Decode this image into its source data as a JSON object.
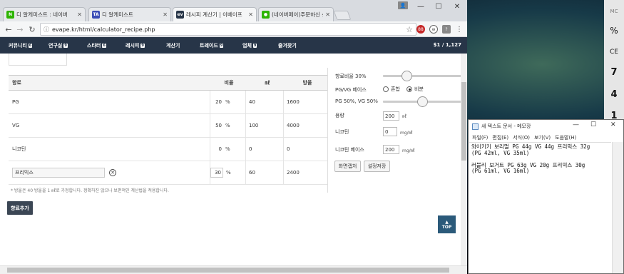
{
  "browser": {
    "tabs": [
      {
        "label": "디 알케미스트 : 네이버",
        "favicon": "N",
        "fav_color": "#2db400",
        "active": false
      },
      {
        "label": "디 알케미스트",
        "favicon": "TA",
        "fav_color": "#3a4bb5",
        "active": false
      },
      {
        "label": "레시피 계산기 | 이베이프",
        "favicon": "ev",
        "fav_color": "#273548",
        "active": true
      },
      {
        "label": "(네이버페이)주문하신 상",
        "favicon": "💬",
        "fav_color": "#2db400",
        "active": false
      }
    ],
    "url": "evape.kr/html/calculator_recipe.php",
    "window_controls": {
      "minimize": "—",
      "maximize": "☐",
      "close": "✕"
    },
    "extension_badge": "88"
  },
  "site_nav": {
    "items": [
      {
        "label": "커뮤니티",
        "badge": "6"
      },
      {
        "label": "연구실",
        "badge": "9"
      },
      {
        "label": "스타터",
        "badge": "6"
      },
      {
        "label": "레시피",
        "badge": "9"
      },
      {
        "label": "계산기",
        "badge": ""
      },
      {
        "label": "트레이드",
        "badge": "9"
      },
      {
        "label": "업체",
        "badge": "9"
      },
      {
        "label": "즐겨찾기",
        "badge": ""
      }
    ],
    "price": "$1 / 1,127"
  },
  "table": {
    "headers": {
      "name": "향료",
      "ratio": "비율",
      "ml": "㎖",
      "drops": "방울"
    },
    "rows": [
      {
        "name": "PG",
        "ratio": "20",
        "unit": "%",
        "ml": "40",
        "drops": "1600"
      },
      {
        "name": "VG",
        "ratio": "50",
        "unit": "%",
        "ml": "100",
        "drops": "4000"
      },
      {
        "name": "니코틴",
        "ratio": "0",
        "unit": "%",
        "ml": "0",
        "drops": "0"
      },
      {
        "name": "프리믹스",
        "ratio": "30",
        "unit": "%",
        "ml": "60",
        "drops": "2400"
      }
    ],
    "note": "* 방울은 40 방울을 1 ㎖로 가정합니다. 정확하진 않으나 보편적인 계산법을 적용합니다.",
    "add_button": "향료추가"
  },
  "panel": {
    "flavor_ratio_label": "향료비율 30%",
    "flavor_ratio_value": 0.3,
    "pgvg_base_label": "PG/VG 베이스",
    "radio_mix": "혼합",
    "radio_ratio": "비분",
    "pgvg_label": "PG 50%, VG 50%",
    "pgvg_value": 0.5,
    "volume_label": "용량",
    "volume_value": "200",
    "volume_unit": "㎖",
    "nicotine_label": "니코틴",
    "nicotine_value": "0",
    "nicotine_unit": "mg/㎖",
    "nic_base_label": "니코틴 베이스",
    "nic_base_value": "200",
    "nic_base_unit": "mg/㎖",
    "btn_capture": "화면캡처",
    "btn_save": "설정저장"
  },
  "top_button": "TOP",
  "notepad": {
    "title": "새 텍스트 문서 - 메모장",
    "menu": [
      "파일(F)",
      "편집(E)",
      "서식(O)",
      "보기(V)",
      "도움말(H)"
    ],
    "text": "와이키키 보리멀 PG 44g VG 44g 프리믹스 32g\n(PG 42ml, VG 35ml)\n\n러블리 보거트 PG 63g VG 20g 프리믹스 30g\n(PG 61ml, VG 16ml)"
  },
  "calculator": {
    "keys": [
      "MC",
      "%",
      "CE",
      "7",
      "4",
      "1"
    ]
  }
}
